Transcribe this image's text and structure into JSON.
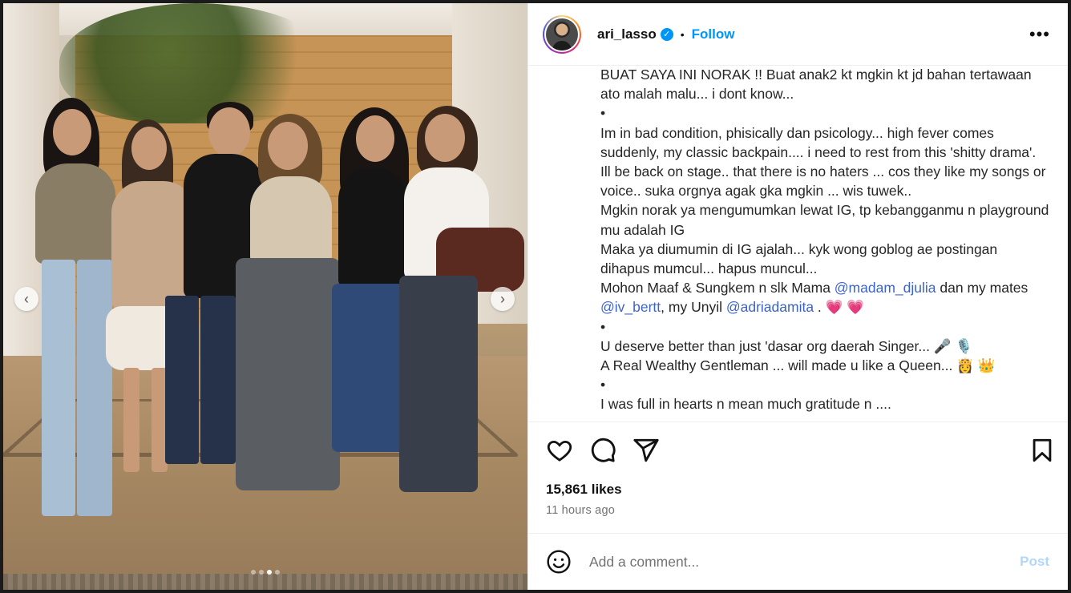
{
  "post": {
    "username": "ari_lasso",
    "follow_label": "Follow",
    "bullet": "•",
    "more_icon": "more-options-icon",
    "likes": "15,861 likes",
    "time_ago": "11 hours ago"
  },
  "caption": {
    "lines": [
      "BUAT SAYA INI NORAK !! Buat anak2 kt mgkin kt jd bahan tertawaan ato malah malu... i dont know...",
      "•",
      "Im in bad condition, phisically dan psicology... high fever comes suddenly, my classic backpain.... i need to rest from this 'shitty drama'.",
      "Ill be back on stage.. that there is no haters ... cos they like my songs or voice.. suka orgnya agak gka mgkin ... wis tuwek..",
      "Mgkin norak ya mengumumkan lewat IG, tp kebanggan­mu n playground mu adalah IG",
      "Maka ya diumumin di IG ajalah... kyk wong goblog ae postingan dihapus mumcul... hapus muncul...",
      "",
      "•",
      "U deserve better than just 'dasar org daerah Singer... 🎤 🎙️",
      "A Real Wealthy Gentleman ... will made u like a Queen... 👸 👑",
      "•",
      "I was full in hearts n mean much gratitude n ...."
    ],
    "mohon_prefix": "Mohon Maaf & Sungkem n slk Mama ",
    "mention_1": "@madam_djulia",
    "mohon_mid": " dan my mates ",
    "mention_2": "@iv_bertt",
    "mohon_mid2": ", my Unyil ",
    "mention_3": "@adriadamita",
    "mohon_end": " . ",
    "hearts": "💗 💗"
  },
  "comment": {
    "placeholder": "Add a comment...",
    "post_label": "Post"
  },
  "carousel": {
    "prev_label": "‹",
    "next_label": "›",
    "dot_count": 4,
    "active_index": 2
  },
  "colors": {
    "follow": "#0095f6",
    "mention": "#3c64c8",
    "post_disabled": "#b3d6fb"
  }
}
